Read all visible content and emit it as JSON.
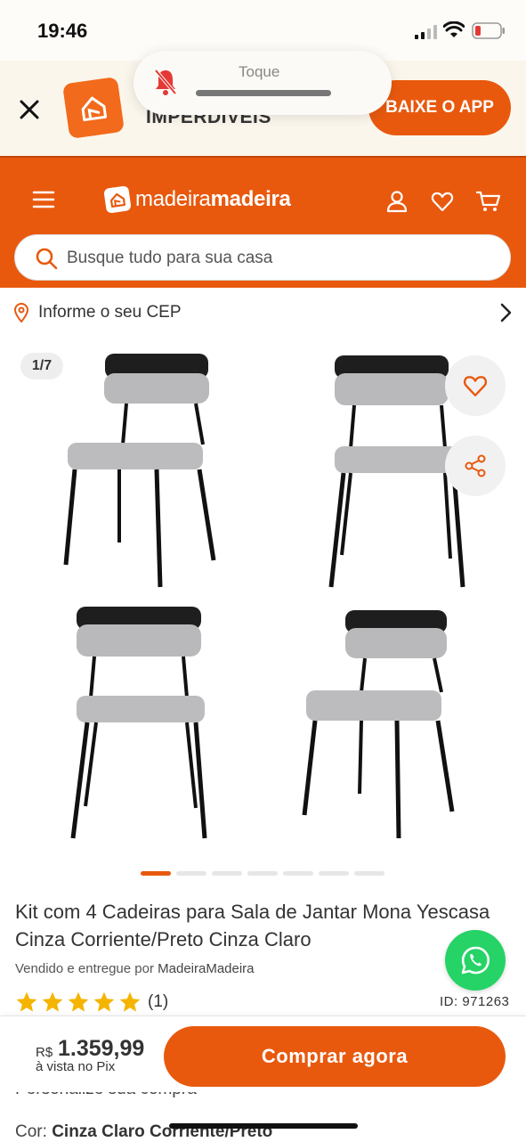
{
  "status_bar": {
    "time": "19:46",
    "battery_color": "#e53935"
  },
  "app_banner": {
    "title": "IMPERDIVEIS",
    "cta_label": "BAIXE O APP",
    "close_icon": "close-icon",
    "logo_icon": "madeiramadeira-app-logo"
  },
  "ringer_toast": {
    "label": "Toque",
    "icon": "bell-slash-icon"
  },
  "header": {
    "brand_light": "madeira",
    "brand_bold": "madeira",
    "menu_icon": "hamburger-menu-icon",
    "account_icon": "user-icon",
    "wishlist_icon": "heart-icon",
    "cart_icon": "cart-icon",
    "accent_color": "#e8590e"
  },
  "search": {
    "placeholder": "Busque tudo para sua casa"
  },
  "cep": {
    "label": "Informe o seu CEP"
  },
  "gallery": {
    "counter": "1/7",
    "active_index": 0,
    "total_dots": 7
  },
  "product": {
    "title": "Kit com 4 Cadeiras para Sala de Jantar Mona Yescasa Cinza Corriente/Preto Cinza Claro",
    "seller_prefix": "Vendido e entregue por",
    "seller_name": "MadeiraMadeira",
    "rating": 5,
    "review_count": "(1)",
    "id_label": "ID: 971263",
    "customize_label": "Personalize sua compra",
    "color_prefix": "Cor:",
    "color_value": "Cinza Claro Corriente/Preto"
  },
  "buy_bar": {
    "currency": "R$",
    "price": "1.359,99",
    "price_note": "à vista no Pix",
    "cta_label": "Comprar agora"
  }
}
